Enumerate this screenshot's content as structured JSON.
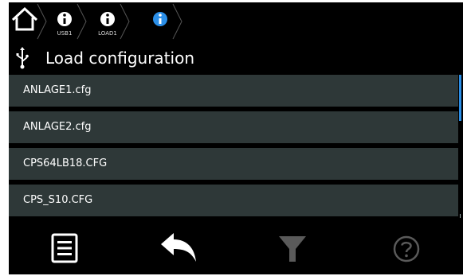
{
  "breadcrumb": {
    "items": [
      {
        "icon": "home-icon",
        "label": ""
      },
      {
        "icon": "info-icon",
        "label": "USB1"
      },
      {
        "icon": "info-icon",
        "label": "LOAD1"
      },
      {
        "icon": "info-icon-active",
        "label": ""
      }
    ]
  },
  "header": {
    "icon": "usb-icon",
    "title": "Load configuration"
  },
  "files": [
    "ANLAGE1.cfg",
    "ANLAGE2.cfg",
    "CPS64LB18.CFG",
    "CPS_S10.CFG"
  ],
  "toolbar": {
    "buttons": [
      {
        "icon": "menu-list-icon",
        "enabled": true
      },
      {
        "icon": "back-arrow-icon",
        "enabled": true
      },
      {
        "icon": "filter-icon",
        "enabled": false
      },
      {
        "icon": "help-icon",
        "enabled": false
      }
    ]
  },
  "colors": {
    "background": "#000000",
    "list_item": "#2e3838",
    "accent": "#2b8fe8",
    "disabled": "#5a5a5a"
  }
}
